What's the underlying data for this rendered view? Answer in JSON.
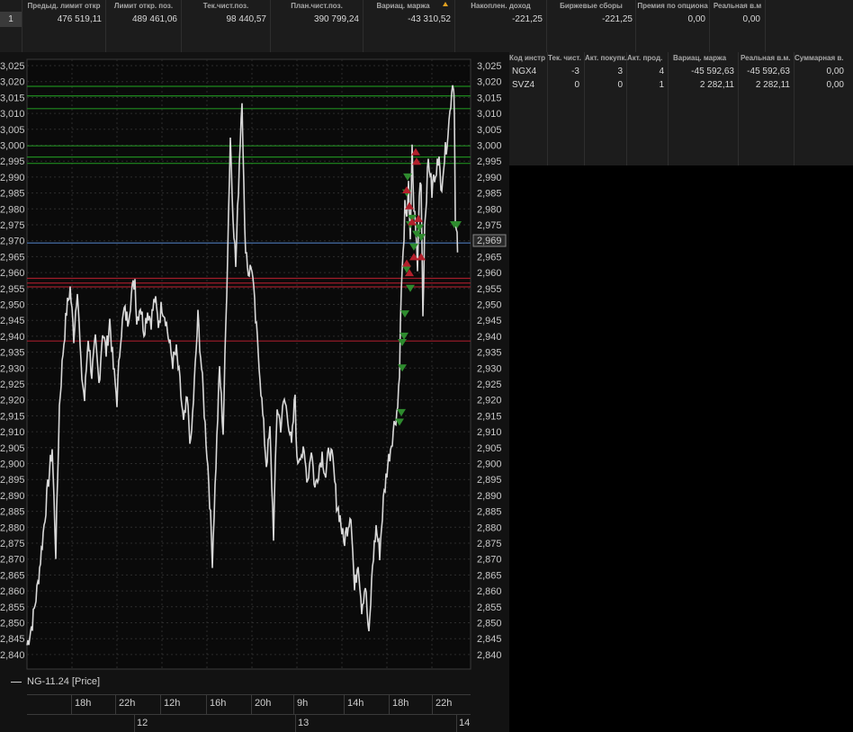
{
  "limits_table": {
    "columns": [
      "Предыд. лимит откр",
      "Лимит откр. поз.",
      "Тек.чист.поз.",
      "План.чист.поз.",
      "Вариац. маржа",
      "Накоплен. доход",
      "Биржевые сборы",
      "Премия по опциона",
      "Реальная в.м"
    ],
    "sort_icon": "sort-up-icon",
    "row": {
      "num": "1",
      "values": [
        "476 519,11",
        "489 461,06",
        "98 440,57",
        "390 799,24",
        "-43 310,52",
        "-221,25",
        "-221,25",
        "0,00",
        "0,00"
      ]
    }
  },
  "positions_table": {
    "columns": [
      "Код инстр",
      "Тек. чист.",
      "Акт. покупк.",
      "Акт. прод.",
      "Вариац. маржа",
      "Реальная в.м.",
      "Суммарная в."
    ],
    "rows": [
      [
        "NGX4",
        "-3",
        "3",
        "4",
        "-45 592,63",
        "-45 592,63",
        "0,00"
      ],
      [
        "SVZ4",
        "0",
        "0",
        "1",
        "2 282,11",
        "2 282,11",
        "0,00"
      ]
    ]
  },
  "chart": {
    "legend": "NG-11.24 [Price]",
    "time_ticks": [
      "18h",
      "22h",
      "12h",
      "16h",
      "20h",
      "9h",
      "14h",
      "18h",
      "22h"
    ],
    "day_labels": [
      "12",
      "13",
      "14"
    ],
    "current_price_label": "2,969",
    "left_axis_labels": [
      "3,025",
      "3,020",
      "3,015",
      "3,010",
      "3,005",
      "3,000",
      "2,995",
      "2,990",
      "2,985",
      "2,980",
      "2,975",
      "2,970",
      "2,965",
      "2,960",
      "2,955",
      "2,950",
      "2,945",
      "2,940",
      "2,935",
      "2,930",
      "2,925",
      "2,920",
      "2,915",
      "2,910",
      "2,905",
      "2,900",
      "2,895",
      "2,890",
      "2,885",
      "2,880",
      "2,875",
      "2,870",
      "2,865",
      "2,860",
      "2,855",
      "2,850",
      "2,845",
      "2,840"
    ],
    "right_axis_labels": [
      "3,025",
      "3,020",
      "3,015",
      "3,010",
      "3,005",
      "3,000",
      "2,995",
      "2,990",
      "2,985",
      "2,980",
      "2,975",
      "2,970",
      "2,965",
      "2,960",
      "2,955",
      "2,950",
      "2,945",
      "2,940",
      "2,935",
      "2,930",
      "2,925",
      "2,920",
      "2,915",
      "2,910",
      "2,905",
      "2,900",
      "2,895",
      "2,890",
      "2,885",
      "2,880",
      "2,875",
      "2,870",
      "2,865",
      "2,860",
      "2,855",
      "2,850",
      "2,845",
      "2,840"
    ],
    "colors": {
      "price_line": "#d8d8d8",
      "green_level": "#1f8a1f",
      "blue_level": "#4d79b8",
      "red_level": "#a11d2a",
      "buy_marker": "#2e8b2e",
      "sell_marker": "#b3202c"
    }
  }
}
